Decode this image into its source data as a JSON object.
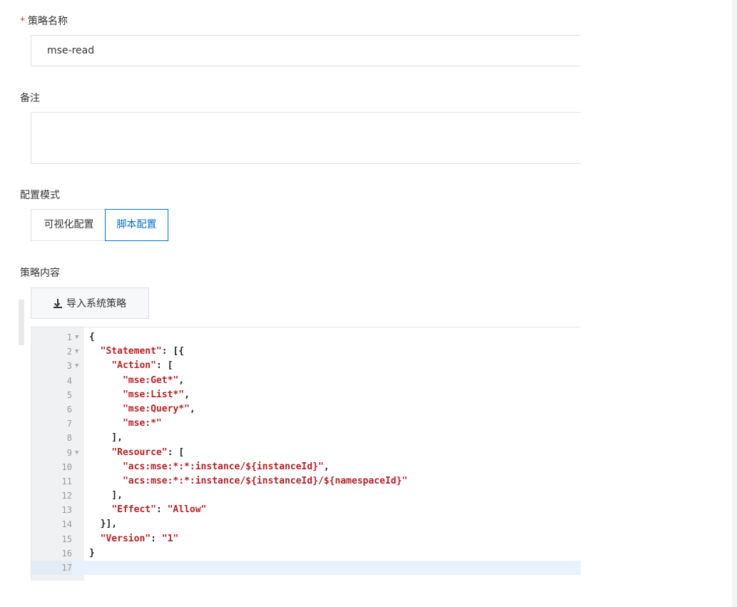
{
  "form": {
    "name_label": "策略名称",
    "name_required": "*",
    "name_value": "mse-read",
    "remark_label": "备注",
    "remark_value": "",
    "mode_label": "配置模式",
    "mode_options": [
      "可视化配置",
      "脚本配置"
    ],
    "mode_selected": "脚本配置",
    "content_label": "策略内容",
    "import_button": "导入系统策略"
  },
  "editor": {
    "lines": [
      {
        "n": "1",
        "fold": true,
        "code": "{"
      },
      {
        "n": "2",
        "fold": true,
        "code": "  \"Statement\": [{"
      },
      {
        "n": "3",
        "fold": true,
        "code": "    \"Action\": ["
      },
      {
        "n": "4",
        "fold": false,
        "code": "      \"mse:Get*\","
      },
      {
        "n": "5",
        "fold": false,
        "code": "      \"mse:List*\","
      },
      {
        "n": "6",
        "fold": false,
        "code": "      \"mse:Query*\","
      },
      {
        "n": "7",
        "fold": false,
        "code": "      \"mse:*\""
      },
      {
        "n": "8",
        "fold": false,
        "code": "    ],"
      },
      {
        "n": "9",
        "fold": true,
        "code": "    \"Resource\": ["
      },
      {
        "n": "10",
        "fold": false,
        "code": "      \"acs:mse:*:*:instance/${instanceId}\","
      },
      {
        "n": "11",
        "fold": false,
        "code": "      \"acs:mse:*:*:instance/${instanceId}/${namespaceId}\""
      },
      {
        "n": "12",
        "fold": false,
        "code": "    ],"
      },
      {
        "n": "13",
        "fold": false,
        "code": "    \"Effect\": \"Allow\""
      },
      {
        "n": "14",
        "fold": false,
        "code": "  }],"
      },
      {
        "n": "15",
        "fold": false,
        "code": "  \"Version\": \"1\""
      },
      {
        "n": "16",
        "fold": false,
        "code": "}"
      },
      {
        "n": "17",
        "fold": false,
        "code": ""
      }
    ],
    "active_line": "17",
    "colors": {
      "string": "#b71f24",
      "punct": "#222222",
      "gutter": "#f0f1f3",
      "active": "#e8f2fe"
    }
  },
  "colors": {
    "accent": "#0070cc",
    "required": "#e0413f",
    "border": "#dcdfe6"
  }
}
